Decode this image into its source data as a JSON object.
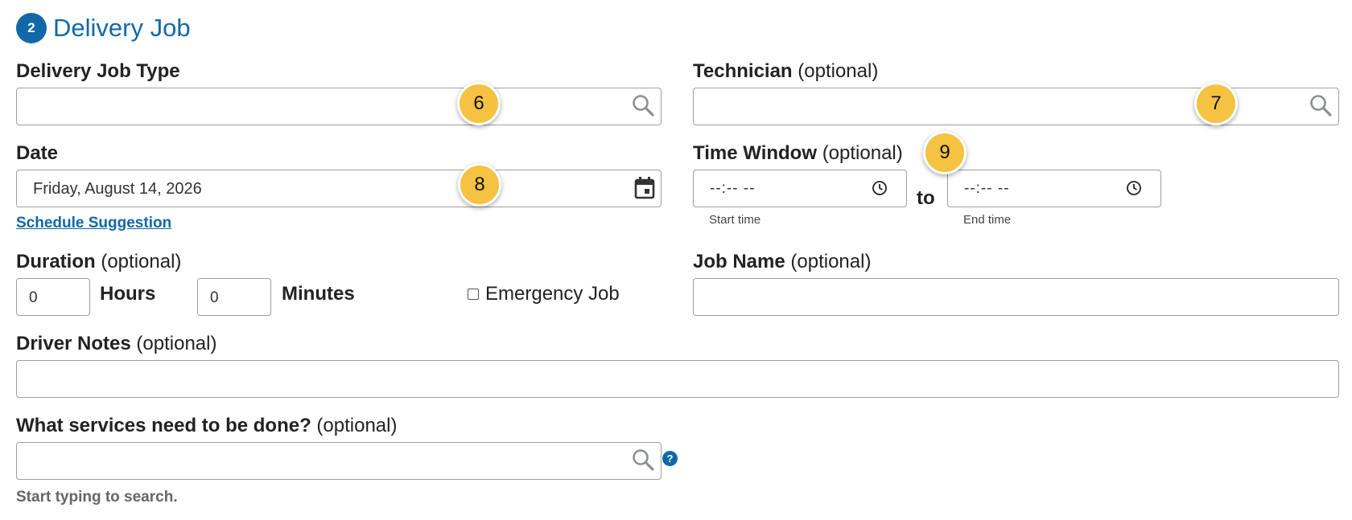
{
  "section": {
    "step_number": "2",
    "title": "Delivery Job"
  },
  "fields": {
    "delivery_job_type": {
      "label": "Delivery Job Type",
      "value": ""
    },
    "technician": {
      "label": "Technician",
      "optional": "(optional)",
      "value": ""
    },
    "date": {
      "label": "Date",
      "value": "Friday, August 14, 2026",
      "link": "Schedule Suggestion"
    },
    "time_window": {
      "label": "Time Window",
      "optional": "(optional)",
      "start_value": "--:-- --",
      "end_value": "--:-- --",
      "to": "to",
      "start_caption": "Start time",
      "end_caption": "End time"
    },
    "duration": {
      "label": "Duration",
      "optional": "(optional)",
      "hours_value": "0",
      "hours_label": "Hours",
      "minutes_value": "0",
      "minutes_label": "Minutes"
    },
    "emergency": {
      "label": "Emergency Job",
      "checked": false
    },
    "job_name": {
      "label": "Job Name",
      "optional": "(optional)",
      "value": ""
    },
    "driver_notes": {
      "label": "Driver Notes",
      "optional": "(optional)",
      "value": ""
    },
    "services": {
      "label": "What services need to be done?",
      "optional": "(optional)",
      "value": "",
      "help": "?",
      "hint": "Start typing to search."
    }
  },
  "callouts": [
    "6",
    "7",
    "8",
    "9"
  ],
  "icons": {
    "search": "search-icon",
    "calendar": "calendar-icon",
    "clock": "clock-icon",
    "help": "help-icon"
  },
  "colors": {
    "accent": "#1168a8",
    "callout": "#f5c242"
  }
}
